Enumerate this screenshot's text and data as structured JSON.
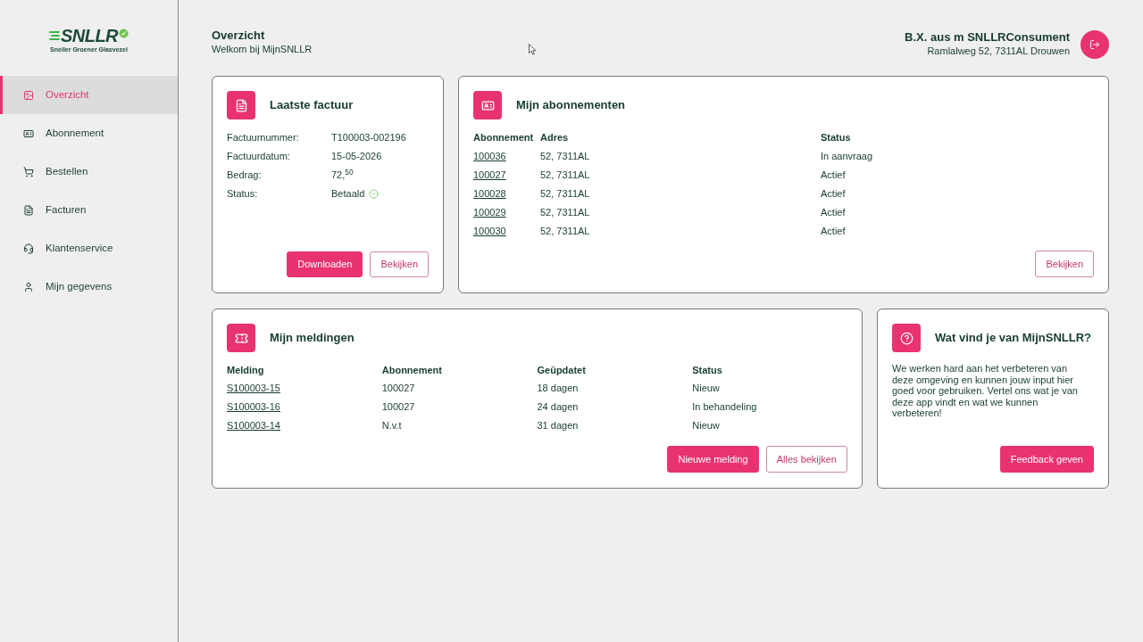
{
  "sidebar": {
    "logo": {
      "wordmark": "SNLLR",
      "tagline": "Sneller Groener Glasvezel"
    },
    "items": [
      {
        "label": "Overzicht",
        "selected": true
      },
      {
        "label": "Abonnement",
        "selected": false
      },
      {
        "label": "Bestellen",
        "selected": false
      },
      {
        "label": "Facturen",
        "selected": false
      },
      {
        "label": "Klantenservice",
        "selected": false
      },
      {
        "label": "Mijn gegevens",
        "selected": false
      }
    ]
  },
  "header": {
    "title": "Overzicht",
    "subtitle": "Welkom bij MijnSNLLR",
    "user_name": "B.X. aus m SNLLRConsument",
    "user_address": "Ramlalweg 52, 7311AL Drouwen"
  },
  "invoice_card": {
    "title": "Laatste factuur",
    "fields": [
      {
        "kind": "text",
        "label": "Factuurnummer:",
        "value": "T100003-002196"
      },
      {
        "kind": "text",
        "label": "Factuurdatum:",
        "value": "15-05-2026"
      },
      {
        "kind": "text",
        "label": "Bedrag:",
        "value": "72,$^{50}$"
      },
      {
        "kind": "status",
        "label": "Status:",
        "value": "Betaald"
      }
    ],
    "buttons": [
      {
        "kind": "primary",
        "label": "Downloaden"
      },
      {
        "kind": "outline",
        "label": "Bekijken"
      }
    ]
  },
  "subscriptions_card": {
    "title": "Mijn abonnementen",
    "columns": [
      "Abonnement",
      "Adres",
      "Status"
    ],
    "rows": [
      {
        "abonnement": "100036",
        "adres": "52, 7311AL",
        "status": "In aanvraag"
      },
      {
        "abonnement": "100027",
        "adres": "52, 7311AL",
        "status": "Actief"
      },
      {
        "abonnement": "100028",
        "adres": "52, 7311AL",
        "status": "Actief"
      },
      {
        "abonnement": "100029",
        "adres": "52, 7311AL",
        "status": "Actief"
      },
      {
        "abonnement": "100030",
        "adres": "52, 7311AL",
        "status": "Actief"
      }
    ],
    "buttons": [
      {
        "kind": "outline",
        "label": "Bekijken"
      }
    ]
  },
  "notifications_card": {
    "title": "Mijn meldingen",
    "columns": [
      "Melding",
      "Abonnement",
      "Geüpdatet",
      "Status"
    ],
    "rows": [
      {
        "melding": "S100003-15",
        "abonnement": "100027",
        "updated": "18 dagen",
        "status": "Nieuw"
      },
      {
        "melding": "S100003-16",
        "abonnement": "100027",
        "updated": "24 dagen",
        "status": "In behandeling"
      },
      {
        "melding": "S100003-14",
        "abonnement": "N.v.t",
        "updated": "31 dagen",
        "status": "Nieuw"
      }
    ],
    "buttons": [
      {
        "kind": "primary",
        "label": "Nieuwe melding"
      },
      {
        "kind": "outline",
        "label": "Alles bekijken"
      }
    ]
  },
  "feedback_card": {
    "title": "Wat vind je van MijnSNLLR?",
    "text": "We werken hard aan het verbeteren van deze omgeving en kunnen jouw input hier goed voor gebruiken. Vertel ons wat je van deze app vindt en wat we kunnen verbeteren!",
    "buttons": [
      {
        "kind": "primary",
        "label": "Feedback geven"
      }
    ]
  }
}
